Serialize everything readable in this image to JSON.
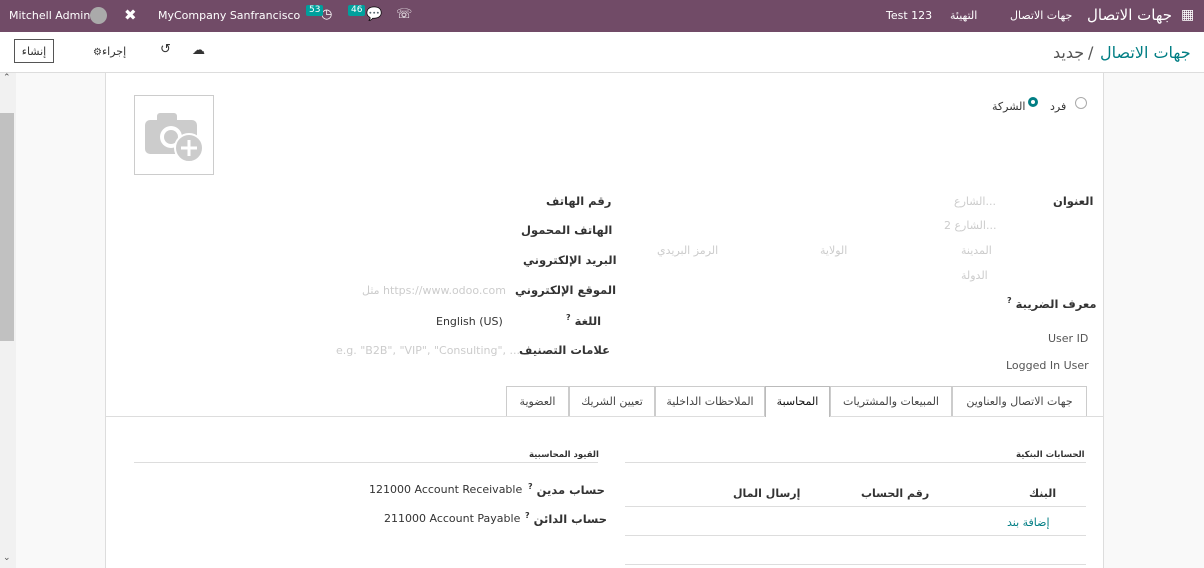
{
  "navbar": {
    "app_name": "جهات الاتصال",
    "menu": [
      "جهات الاتصال",
      "التهيئة",
      "Test 123"
    ],
    "user": "Mitchell Admin",
    "company": "MyCompany Sanfrancisco",
    "activity_count": "53",
    "message_count": "46",
    "bg_color": "#714b67"
  },
  "control_panel": {
    "breadcrumb_parent": "جهات الاتصال",
    "breadcrumb_sep": "/",
    "breadcrumb_current": "جديد",
    "create_label": "إنشاء",
    "action_label": "إجراء"
  },
  "form": {
    "type_individual": "فرد",
    "type_company": "الشركة",
    "address_label": "العنوان",
    "street_ph": "الشارع...",
    "street2_ph": "الشارع 2...",
    "city_ph": "المدينة",
    "state_ph": "الولاية",
    "zip_ph": "الرمز البريدي",
    "country_ph": "الدولة",
    "vat_label": "معرف الضريبة",
    "user_id_label": "User ID",
    "logged_in_label": "Logged In User",
    "phone_label": "رقم الهاتف",
    "mobile_label": "الهاتف المحمول",
    "email_label": "البريد الإلكتروني",
    "website_label": "الموقع الإلكتروني",
    "website_ph": "مثل https://www.odoo.com",
    "lang_label": "اللغة",
    "lang_value": "English (US)",
    "tags_label": "علامات التصنيف",
    "tags_ph": "e.g. \"B2B\", \"VIP\", \"Consulting\", ...",
    "help_mark": "?"
  },
  "tabs": [
    "جهات الاتصال والعناوين",
    "المبيعات والمشتريات",
    "المحاسبة",
    "الملاحظات الداخلية",
    "تعيين الشريك",
    "العضوية"
  ],
  "active_tab": "المحاسبة",
  "accounting": {
    "bank_section": "الحسابات البنكية",
    "bank_headers": [
      "البنك",
      "رقم الحساب",
      "إرسال المال"
    ],
    "add_line": "إضافة بند",
    "entries_section": "القيود المحاسبية",
    "receivable_label": "حساب مدين",
    "receivable_value": "121000 Account Receivable",
    "payable_label": "حساب الدائن",
    "payable_value": "211000 Account Payable"
  }
}
